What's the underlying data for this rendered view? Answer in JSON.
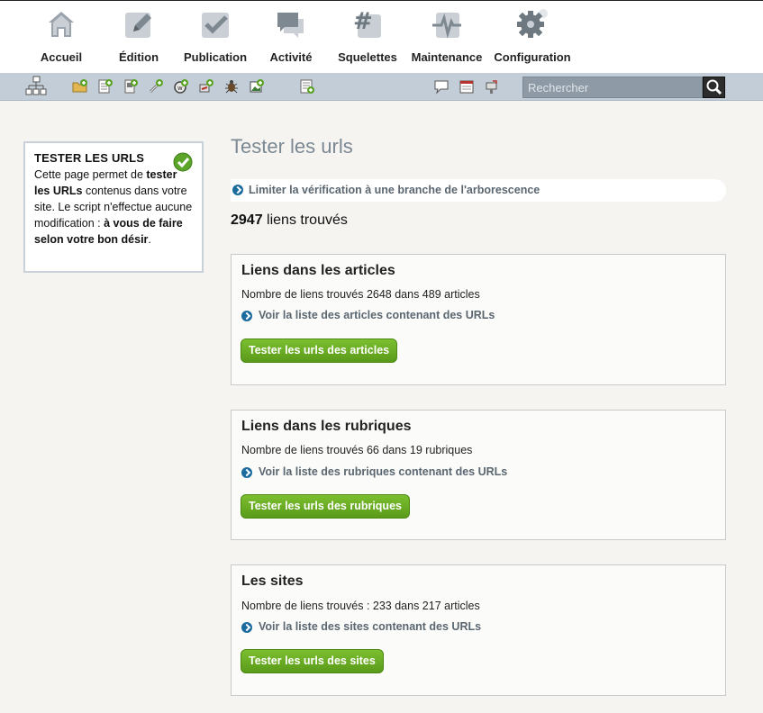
{
  "nav": {
    "items": [
      {
        "label": "Accueil",
        "icon": "home-icon"
      },
      {
        "label": "Édition",
        "icon": "pencil-icon"
      },
      {
        "label": "Publication",
        "icon": "checkmark-icon"
      },
      {
        "label": "Activité",
        "icon": "chat-bubbles-icon"
      },
      {
        "label": "Squelettes",
        "icon": "hash-icon"
      },
      {
        "label": "Maintenance",
        "icon": "pulse-icon"
      },
      {
        "label": "Configuration",
        "icon": "gear-icon"
      }
    ]
  },
  "toolbar": {
    "icons": [
      "sitemap-icon",
      "new-folder-icon",
      "new-article-icon",
      "new-page-icon",
      "new-link-icon",
      "new-breve-icon",
      "new-site-icon",
      "bug-icon",
      "new-image-icon",
      "new-document-icon",
      "comment-icon",
      "calendar-icon",
      "mailbox-icon"
    ],
    "search_placeholder": "Rechercher"
  },
  "infobox": {
    "title": "TESTER LES URLS",
    "text_1": "Cette page permet de ",
    "text_bold_1": "tester les URLs",
    "text_2": " contenus dans votre site. Le script n'effectue aucune modification : ",
    "text_bold_2": "à vous de faire selon votre bon désir",
    "text_3": "."
  },
  "main": {
    "title": "Tester les urls",
    "branch_link": "Limiter la vérification à une branche de l'arborescence",
    "count": "2947",
    "count_suffix": " liens trouvés",
    "cards": [
      {
        "title": "Liens dans les articles",
        "text": "Nombre de liens trouvés 2648 dans 489 articles",
        "link": "Voir la liste des articles contenant des URLs",
        "button": "Tester les urls des articles"
      },
      {
        "title": "Liens dans les rubriques",
        "text": "Nombre de liens trouvés 66 dans 19 rubriques",
        "link": "Voir la liste des rubriques contenant des URLs",
        "button": "Tester les urls des rubriques"
      },
      {
        "title": "Les sites",
        "text": "Nombre de liens trouvés : 233 dans 217 articles",
        "link": "Voir la liste des sites contenant des URLs",
        "button": "Tester les urls des sites"
      }
    ]
  },
  "colors": {
    "toolbar_bg": "#c2cdd7",
    "button_green": "#6aab24",
    "link_bullet": "#1c6b9e",
    "title_grey": "#7b8893"
  }
}
